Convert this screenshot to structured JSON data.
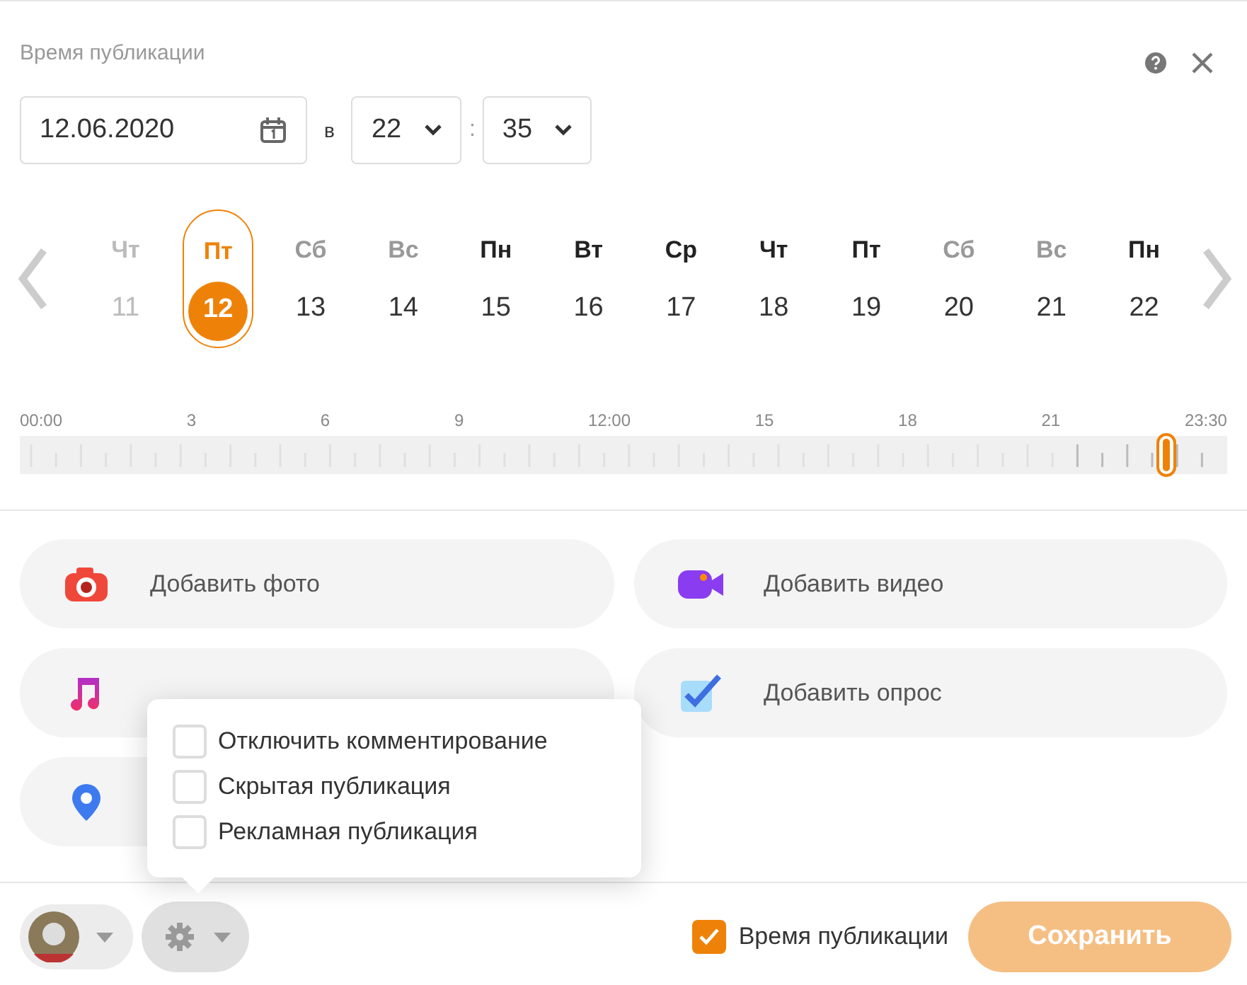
{
  "title": "Время публикации",
  "date_field": {
    "value": "12.06.2020"
  },
  "at_label": "в",
  "hour_select": {
    "value": "22"
  },
  "time_separator": ":",
  "minute_select": {
    "value": "35"
  },
  "days": [
    {
      "weekday": "Чт",
      "day": "11",
      "kind": "past",
      "selected": false
    },
    {
      "weekday": "Пт",
      "day": "12",
      "kind": "weekday",
      "selected": true
    },
    {
      "weekday": "Сб",
      "day": "13",
      "kind": "weekend",
      "selected": false
    },
    {
      "weekday": "Вс",
      "day": "14",
      "kind": "weekend",
      "selected": false
    },
    {
      "weekday": "Пн",
      "day": "15",
      "kind": "weekday",
      "selected": false
    },
    {
      "weekday": "Вт",
      "day": "16",
      "kind": "weekday",
      "selected": false
    },
    {
      "weekday": "Ср",
      "day": "17",
      "kind": "weekday",
      "selected": false
    },
    {
      "weekday": "Чт",
      "day": "18",
      "kind": "weekday",
      "selected": false
    },
    {
      "weekday": "Пт",
      "day": "19",
      "kind": "weekday",
      "selected": false
    },
    {
      "weekday": "Сб",
      "day": "20",
      "kind": "weekend",
      "selected": false
    },
    {
      "weekday": "Вс",
      "day": "21",
      "kind": "weekend",
      "selected": false
    },
    {
      "weekday": "Пн",
      "day": "22",
      "kind": "weekday",
      "selected": false
    }
  ],
  "timeline": {
    "labels": [
      "00:00",
      "3",
      "6",
      "9",
      "12:00",
      "15",
      "18",
      "21",
      "23:30"
    ],
    "level": 0.95
  },
  "attachments": [
    {
      "kind": "photo",
      "label": "Добавить фото"
    },
    {
      "kind": "video",
      "label": "Добавить видео"
    },
    {
      "kind": "music"
    },
    {
      "kind": "poll",
      "label": "Добавить опрос"
    },
    {
      "kind": "place"
    }
  ],
  "settings_menu": [
    {
      "label": "Отключить комментирование",
      "checked": false
    },
    {
      "label": "Скрытая публикация",
      "checked": false
    },
    {
      "label": "Рекламная публикация",
      "checked": false
    }
  ],
  "publish_time": {
    "label": "Время публикации",
    "checked": true
  },
  "save_button": "Сохранить"
}
